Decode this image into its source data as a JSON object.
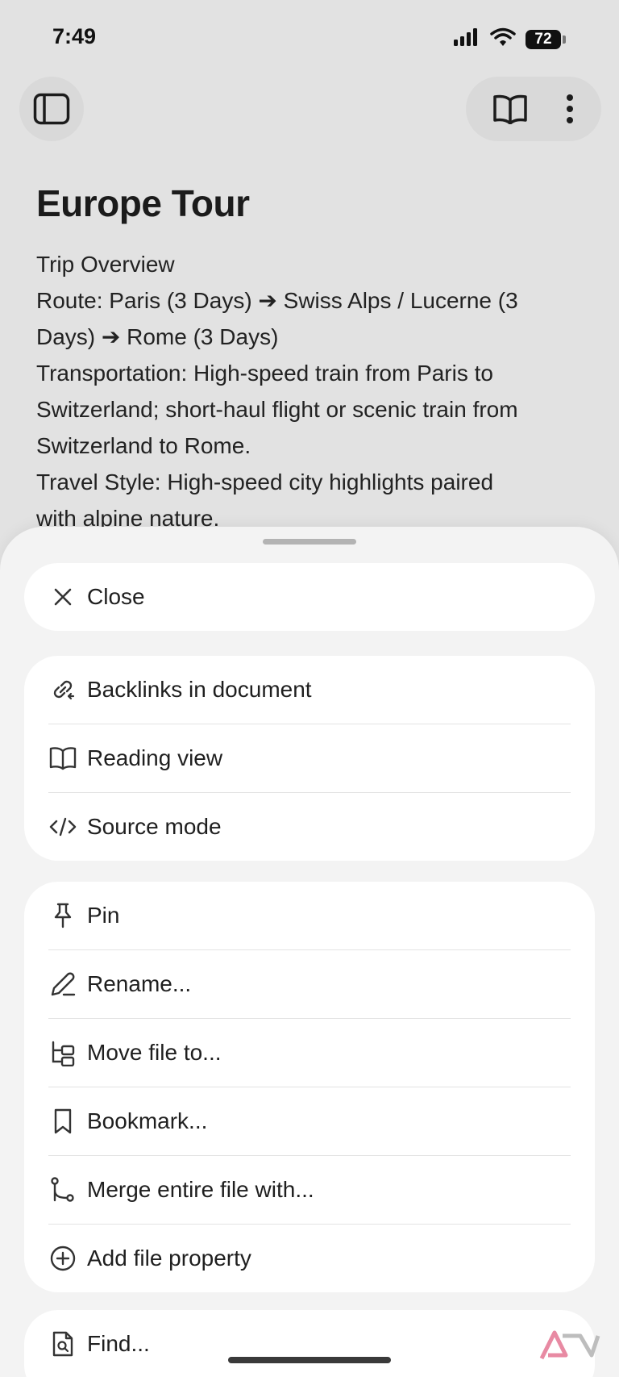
{
  "status_bar": {
    "time": "7:49",
    "battery": "72"
  },
  "toolbar": {
    "sidebar_icon": "sidebar-toggle-icon",
    "reading_icon": "book-open-icon",
    "more_icon": "more-vertical-icon"
  },
  "document": {
    "title": "Europe Tour",
    "lines": [
      "Trip Overview",
      "Route: Paris (3 Days) ➔ Swiss Alps / Lucerne (3",
      "Days) ➔ Rome (3 Days)",
      "Transportation: High-speed train from Paris to",
      "Switzerland; short-haul flight or scenic train from",
      "Switzerland to Rome.",
      "Travel Style: High-speed city highlights paired",
      "with alpine nature."
    ]
  },
  "sheet": {
    "close": {
      "label": "Close",
      "icon": "close-icon"
    },
    "group1": [
      {
        "label": "Backlinks in document",
        "icon": "backlinks-icon"
      },
      {
        "label": "Reading view",
        "icon": "book-open-icon"
      },
      {
        "label": "Source mode",
        "icon": "code-icon"
      }
    ],
    "group2": [
      {
        "label": "Pin",
        "icon": "pin-icon"
      },
      {
        "label": "Rename...",
        "icon": "pencil-icon"
      },
      {
        "label": "Move file to...",
        "icon": "folder-tree-icon"
      },
      {
        "label": "Bookmark...",
        "icon": "bookmark-icon"
      },
      {
        "label": "Merge entire file with...",
        "icon": "merge-icon"
      },
      {
        "label": "Add file property",
        "icon": "plus-circle-icon"
      }
    ],
    "group3": [
      {
        "label": "Find...",
        "icon": "file-search-icon"
      }
    ]
  },
  "colors": {
    "background": "#e2e2e2",
    "sheet": "#f3f3f3",
    "card": "#ffffff",
    "text": "#1f1f1f"
  }
}
